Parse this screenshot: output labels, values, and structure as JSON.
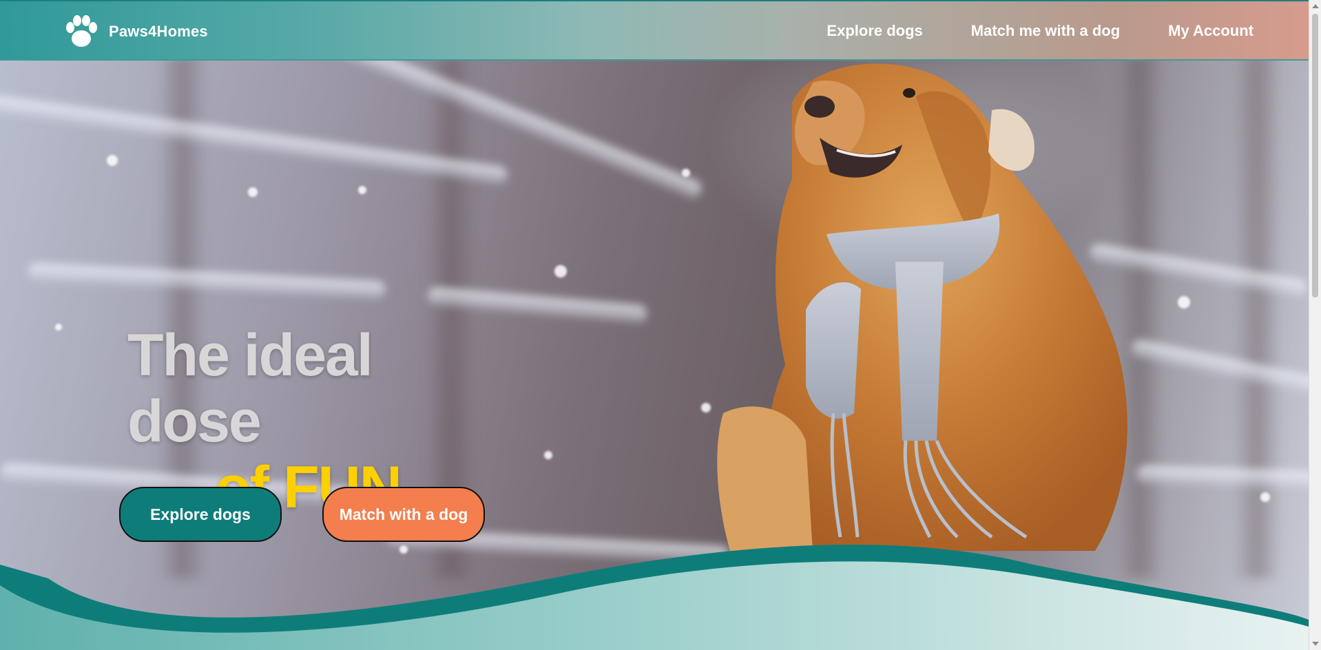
{
  "brand": {
    "name": "Paws4Homes",
    "logo_icon": "paw-icon"
  },
  "nav": {
    "items": [
      {
        "label": "Explore dogs"
      },
      {
        "label": "Match me with a dog"
      },
      {
        "label": "My Account"
      }
    ]
  },
  "hero": {
    "headline_line1": "The ideal dose",
    "headline_line2_a": "of",
    "headline_line2_b": "FUN",
    "primary_button": "Explore dogs",
    "secondary_button": "Match with a dog",
    "image_subject": "golden retriever wearing a grey knitted scarf in snowy forest"
  },
  "colors": {
    "teal": "#0e7d7a",
    "orange": "#f47e4d",
    "yellow": "#ffd000",
    "nav_gradient_start": "#2f9a99",
    "nav_gradient_end": "#d79b8d"
  }
}
